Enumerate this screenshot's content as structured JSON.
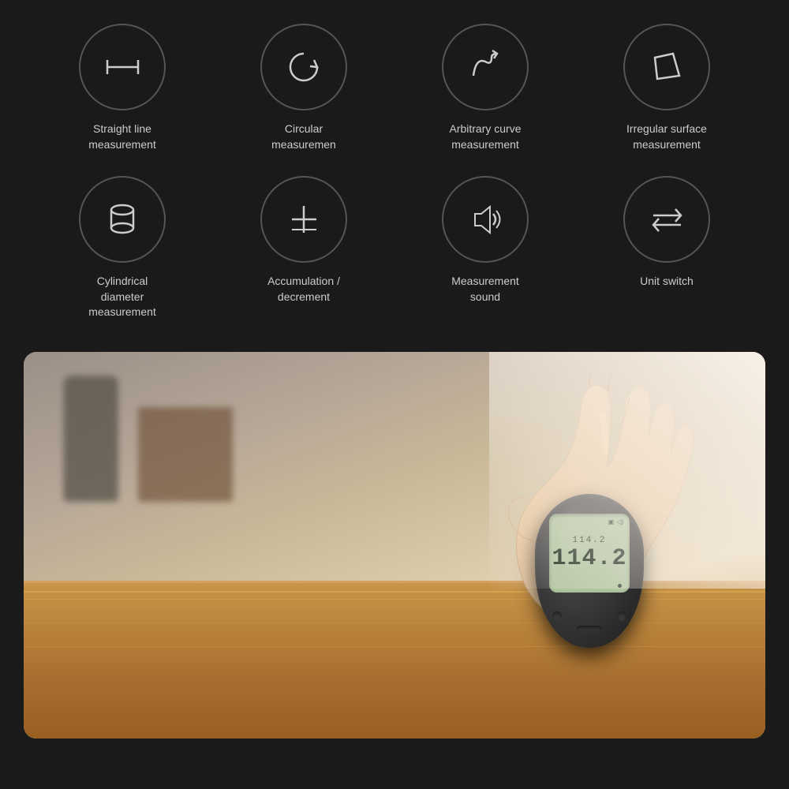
{
  "features": {
    "row1": [
      {
        "id": "straight-line",
        "label": "Straight line\nmeasurement",
        "icon": "straight-line"
      },
      {
        "id": "circular",
        "label": "Circular\nmeasuremen",
        "icon": "circular"
      },
      {
        "id": "arbitrary-curve",
        "label": "Arbitrary curve\nmeasurement",
        "icon": "arbitrary-curve"
      },
      {
        "id": "irregular-surface",
        "label": "Irregular surface\nmeasurement",
        "icon": "irregular-surface"
      }
    ],
    "row2": [
      {
        "id": "cylindrical",
        "label": "Cylindrical\ndiameter\nmeasurement",
        "icon": "cylindrical"
      },
      {
        "id": "accumulation",
        "label": "Accumulation /\ndecrement",
        "icon": "accumulation"
      },
      {
        "id": "sound",
        "label": "Measurement\nsound",
        "icon": "sound"
      },
      {
        "id": "unit-switch",
        "label": "Unit switch",
        "icon": "unit-switch"
      }
    ]
  },
  "device": {
    "screen_small": "114.2",
    "screen_large": "114.2"
  }
}
